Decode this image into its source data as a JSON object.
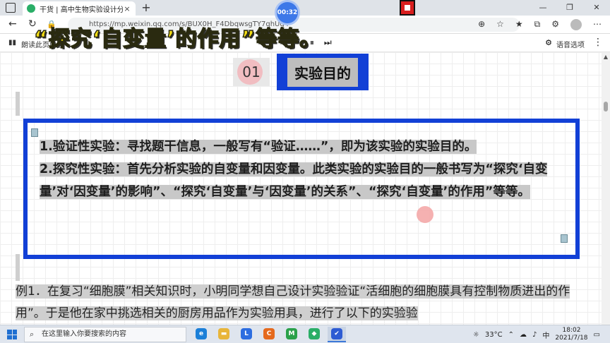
{
  "browser": {
    "tab_title": "干货 | 高中生物实验设计分析及答题技巧",
    "tab_close": "×",
    "new_tab": "+",
    "timer": "00:32",
    "url": "https://mp.weixin.qq.com/s/BUX0H_F4DbqwsgTY7qhUg4",
    "win_min": "—",
    "win_max": "❐",
    "win_close": "✕"
  },
  "readbar": {
    "read_label": "朗读此页内容",
    "voice_label": "语音选项"
  },
  "overlay_caption": "“探究‘自变量’的作用”等等。",
  "section": {
    "number": "01",
    "title": "实验目的"
  },
  "frame_lines": [
    "1.验证性实验：寻找题干信息，一般写有“验证……”，即为该实验的实验目的。",
    "2.探究性实验：首先分析实验的自变量和因变量。此类实验的实验目的一般书写为“探究‘自变量’对‘因变量’的影响”、“探究‘自变量’与‘因变量’的关系”、“探究‘自变量’的作用”等等。"
  ],
  "example_text": "例1．在复习“细胞膜”相关知识时，小明同学想自己设计实验验证“活细胞的细胞膜具有控制物质进出的作用”。于是他在家中挑选相关的厨房用品作为实验用具，进行了以下的实验验",
  "taskbar": {
    "search_placeholder": "在这里输入你要搜索的内容",
    "apps": [
      {
        "name": "edge",
        "label": "e",
        "color": "#1b7fd8"
      },
      {
        "name": "files",
        "label": "▬",
        "color": "#e8b53a"
      },
      {
        "name": "app-l",
        "label": "L",
        "color": "#2c6de0"
      },
      {
        "name": "app-c",
        "label": "C",
        "color": "#e56a1e"
      },
      {
        "name": "app-m",
        "label": "M",
        "color": "#2aa14a"
      },
      {
        "name": "wechat",
        "label": "◆",
        "color": "#2aae67"
      },
      {
        "name": "shield",
        "label": "✔",
        "color": "#2d5bd3"
      }
    ],
    "temperature": "33°C",
    "time": "18:02",
    "date": "2021/7/18"
  },
  "colors": {
    "frame_blue": "#1240d6",
    "caption_yellow": "#f4dd15",
    "highlight_gray": "#c8c8c8"
  }
}
